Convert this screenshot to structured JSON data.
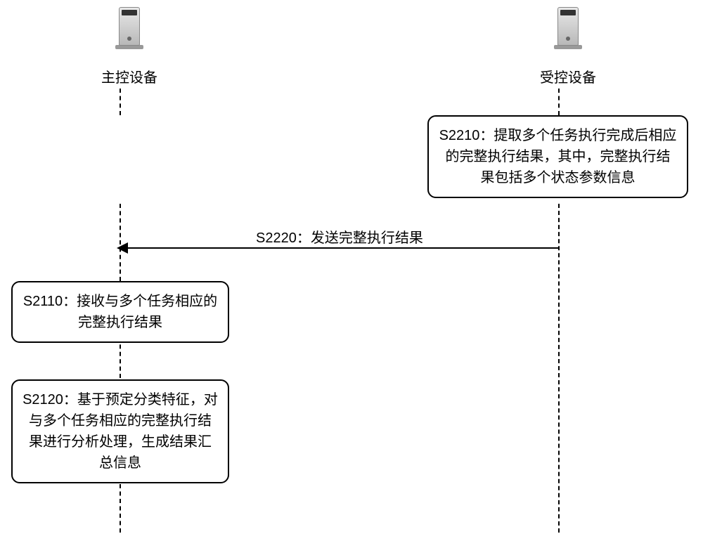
{
  "lifelines": {
    "left": {
      "label": "主控设备"
    },
    "right": {
      "label": "受控设备"
    }
  },
  "boxes": {
    "s2210": "S2210：提取多个任务执行完成后相应的完整执行结果，其中，完整执行结果包括多个状态参数信息",
    "s2110": "S2110：接收与多个任务相应的完整执行结果",
    "s2120": "S2120：基于预定分类特征，对与多个任务相应的完整执行结果进行分析处理，生成结果汇总信息"
  },
  "messages": {
    "s2220": "S2220：发送完整执行结果"
  },
  "chart_data": {
    "type": "sequence-diagram",
    "participants": [
      "主控设备",
      "受控设备"
    ],
    "steps": [
      {
        "at": "受控设备",
        "action": "S2210",
        "text": "提取多个任务执行完成后相应的完整执行结果，其中，完整执行结果包括多个状态参数信息"
      },
      {
        "from": "受控设备",
        "to": "主控设备",
        "action": "S2220",
        "text": "发送完整执行结果"
      },
      {
        "at": "主控设备",
        "action": "S2110",
        "text": "接收与多个任务相应的完整执行结果"
      },
      {
        "at": "主控设备",
        "action": "S2120",
        "text": "基于预定分类特征，对与多个任务相应的完整执行结果进行分析处理，生成结果汇总信息"
      }
    ]
  }
}
